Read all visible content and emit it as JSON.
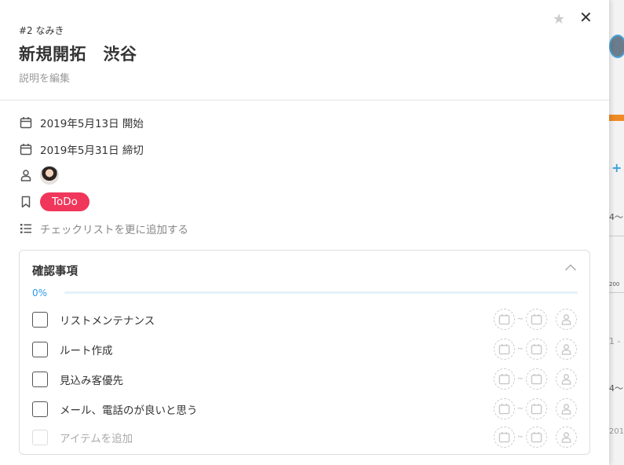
{
  "modal": {
    "task_number": "#2 なみき",
    "title": "新規開拓　渋谷",
    "edit_description": "説明を編集",
    "star_glyph": "★",
    "close_glyph": "✕"
  },
  "meta": {
    "start": {
      "date": "2019年5月13日",
      "label": "開始",
      "text": "2019年5月13日 開始"
    },
    "due": {
      "date": "2019年5月31日",
      "label": "締切",
      "text": "2019年5月31日 締切"
    },
    "status": "ToDo",
    "status_color": "#f0365a",
    "add_checklist": "チェックリストを更に追加する"
  },
  "checklist": {
    "title": "確認事項",
    "progress_text": "0%",
    "progress": 0,
    "accent": "#2a9be8",
    "items": [
      {
        "label": "リストメンテナンス",
        "checked": false
      },
      {
        "label": "ルート作成",
        "checked": false
      },
      {
        "label": "見込み客優先",
        "checked": false
      },
      {
        "label": "メール、電話のが良いと思う",
        "checked": false
      }
    ],
    "add_item_placeholder": "アイテムを追加",
    "range_separator": "~"
  },
  "background": {
    "text_1": "4～",
    "text_2": "200",
    "text_3": "1 -",
    "text_4": "4～",
    "text_5": "201"
  },
  "icons": [
    "calendar-icon",
    "user-icon",
    "bookmark-icon",
    "list-icon",
    "chevron-up-icon",
    "star-icon",
    "close-icon"
  ]
}
